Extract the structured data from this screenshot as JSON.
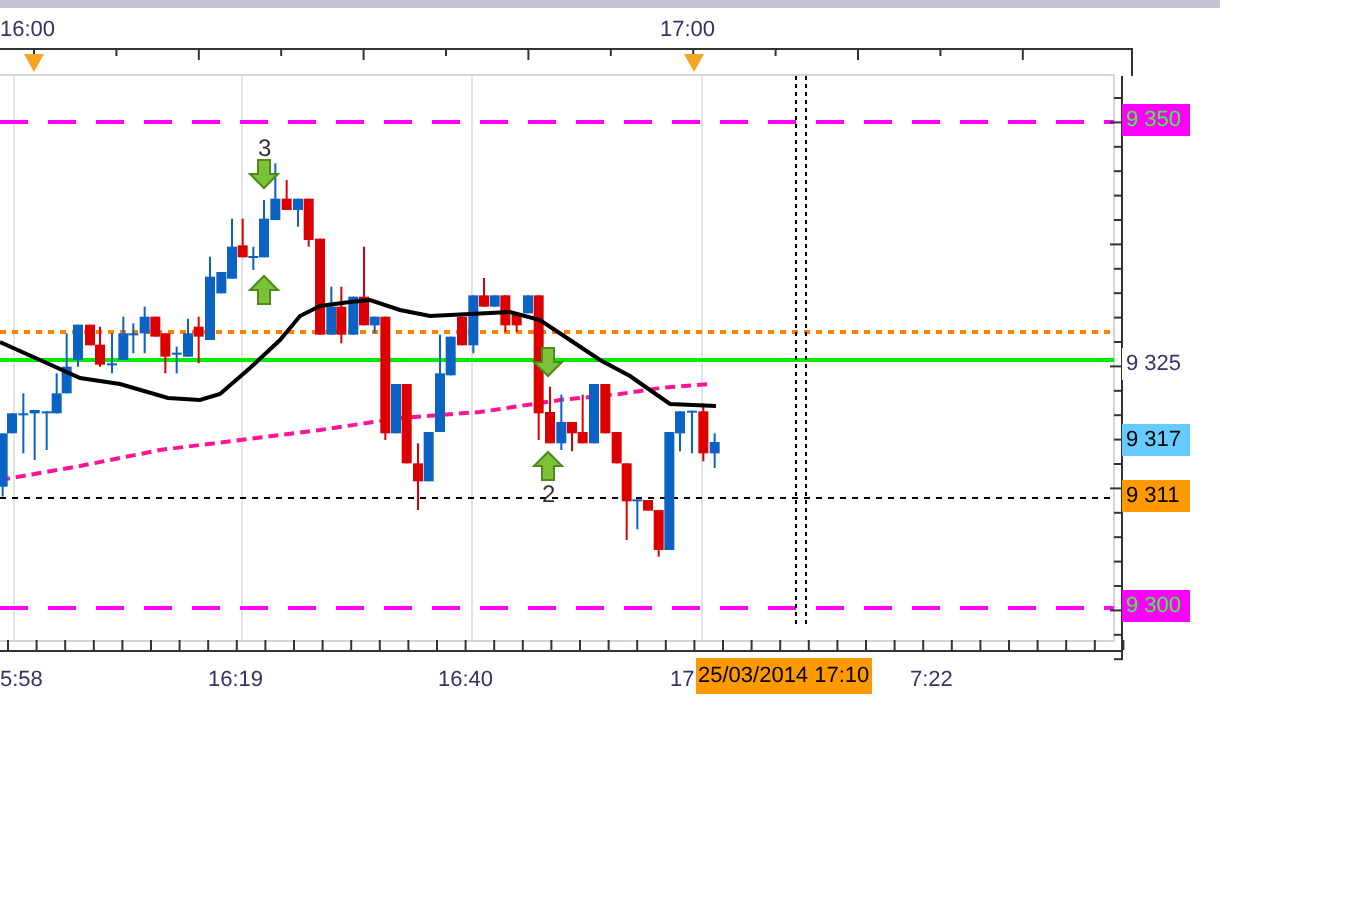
{
  "top_axis": {
    "labels": [
      "16:00",
      "17:00"
    ]
  },
  "price_axis": {
    "labels": [
      {
        "text": "9 350",
        "kind": "line",
        "color": "#ff00ff"
      },
      {
        "text": "9 325",
        "kind": "tick",
        "color": "#ffffff"
      },
      {
        "text": "9 317",
        "kind": "marker",
        "color": "#66ccff"
      },
      {
        "text": "9 311",
        "kind": "marker",
        "color": "#ff9900"
      },
      {
        "text": "9 300",
        "kind": "line",
        "color": "#ff00ff"
      }
    ]
  },
  "signals": [
    {
      "kind": "down",
      "label": "3"
    },
    {
      "kind": "up"
    },
    {
      "kind": "down"
    },
    {
      "kind": "up",
      "label": "2"
    }
  ],
  "time_axis": {
    "labels": [
      "5:58",
      "16:19",
      "16:40",
      "17",
      "7:22"
    ],
    "cursor_label": "25/03/2014 17:10"
  }
}
